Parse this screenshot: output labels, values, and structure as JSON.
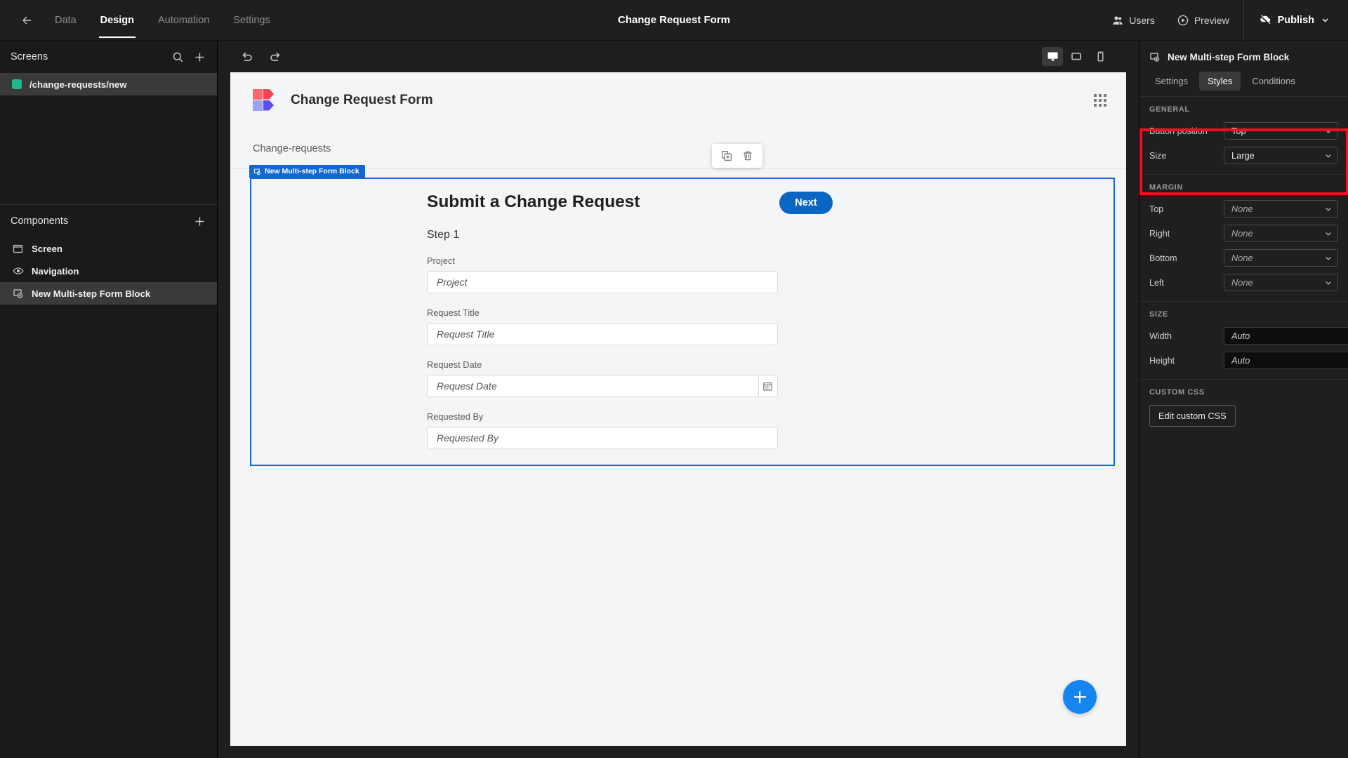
{
  "topbar": {
    "back_icon": "arrow-left-icon",
    "nav": [
      {
        "label": "Data",
        "active": false
      },
      {
        "label": "Design",
        "active": true
      },
      {
        "label": "Automation",
        "active": false
      },
      {
        "label": "Settings",
        "active": false
      }
    ],
    "title": "Change Request Form",
    "users_label": "Users",
    "preview_label": "Preview",
    "publish_label": "Publish"
  },
  "sidebar": {
    "screens_title": "Screens",
    "screens": [
      {
        "label": "/change-requests/new",
        "selected": true,
        "dot_color": "#1fb98c"
      }
    ],
    "components_title": "Components",
    "components": [
      {
        "label": "Screen",
        "icon": "screen-icon",
        "selected": false
      },
      {
        "label": "Navigation",
        "icon": "eye-icon",
        "selected": false
      },
      {
        "label": "New Multi-step Form Block",
        "icon": "form-block-icon",
        "selected": true
      }
    ]
  },
  "canvas_toolbar": {
    "undo_icon": "undo-icon",
    "redo_icon": "redo-icon",
    "devices": [
      {
        "name": "desktop-icon",
        "active": true
      },
      {
        "name": "tablet-icon",
        "active": false
      },
      {
        "name": "mobile-icon",
        "active": false
      }
    ]
  },
  "canvas": {
    "app_title": "Change Request Form",
    "grid_icon": "grid-dots-icon",
    "breadcrumb": "Change-requests",
    "float_tools": [
      {
        "name": "duplicate-icon"
      },
      {
        "name": "delete-icon"
      }
    ],
    "block_tag": "New Multi-step Form Block",
    "form": {
      "title": "Submit a Change Request",
      "next_label": "Next",
      "step_label": "Step 1",
      "fields": [
        {
          "label": "Project",
          "placeholder": "Project",
          "type": "text"
        },
        {
          "label": "Request Title",
          "placeholder": "Request Title",
          "type": "text"
        },
        {
          "label": "Request Date",
          "placeholder": "Request Date",
          "type": "date"
        },
        {
          "label": "Requested By",
          "placeholder": "Requested By",
          "type": "text"
        }
      ]
    },
    "fab_icon": "plus-icon"
  },
  "right_panel": {
    "header_title": "New Multi-step Form Block",
    "header_icon": "form-block-icon",
    "tabs": [
      {
        "label": "Settings",
        "active": false
      },
      {
        "label": "Styles",
        "active": true
      },
      {
        "label": "Conditions",
        "active": false
      }
    ],
    "general": {
      "title": "GENERAL",
      "rows": [
        {
          "label": "Button position",
          "value": "Top",
          "control": "select"
        },
        {
          "label": "Size",
          "value": "Large",
          "control": "select"
        }
      ]
    },
    "margin": {
      "title": "MARGIN",
      "rows": [
        {
          "label": "Top",
          "value": "None",
          "control": "select"
        },
        {
          "label": "Right",
          "value": "None",
          "control": "select"
        },
        {
          "label": "Bottom",
          "value": "None",
          "control": "select"
        },
        {
          "label": "Left",
          "value": "None",
          "control": "select"
        }
      ]
    },
    "size": {
      "title": "SIZE",
      "rows": [
        {
          "label": "Width",
          "value": "Auto",
          "control": "input"
        },
        {
          "label": "Height",
          "value": "Auto",
          "control": "input"
        }
      ]
    },
    "custom_css": {
      "title": "CUSTOM CSS",
      "button_label": "Edit custom CSS"
    },
    "highlight_color": "#ff0a20"
  }
}
